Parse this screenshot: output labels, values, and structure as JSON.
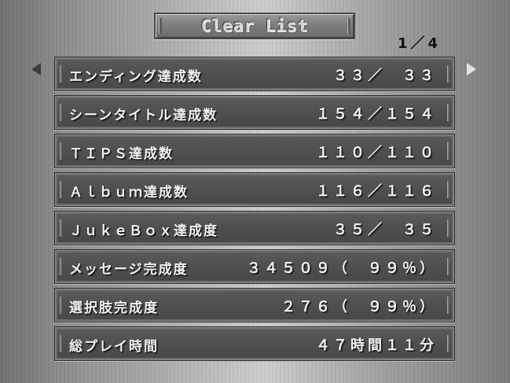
{
  "header": {
    "title": "Clear List",
    "page_indicator": "1／4"
  },
  "nav": {
    "prev_icon": "left-triangle-arrow-icon",
    "next_icon": "right-triangle-arrow-icon"
  },
  "rows": [
    {
      "label": "エンディング達成数",
      "value": "３３／　３３"
    },
    {
      "label": "シーンタイトル達成数",
      "value": "１５４／１５４"
    },
    {
      "label": "ＴＩＰＳ達成数",
      "value": "１１０／１１０"
    },
    {
      "label": "Ａｌｂｕｍ達成数",
      "value": "１１６／１１６"
    },
    {
      "label": "ＪｕｋｅＢｏｘ達成度",
      "value": "３５／　３５"
    },
    {
      "label": "メッセージ完成度",
      "value": "３４５０９（　９９％）"
    },
    {
      "label": "選択肢完成度",
      "value": "２７６（　９９％）"
    },
    {
      "label": "総プレイ時間",
      "value": "４７時間１１分"
    }
  ]
}
